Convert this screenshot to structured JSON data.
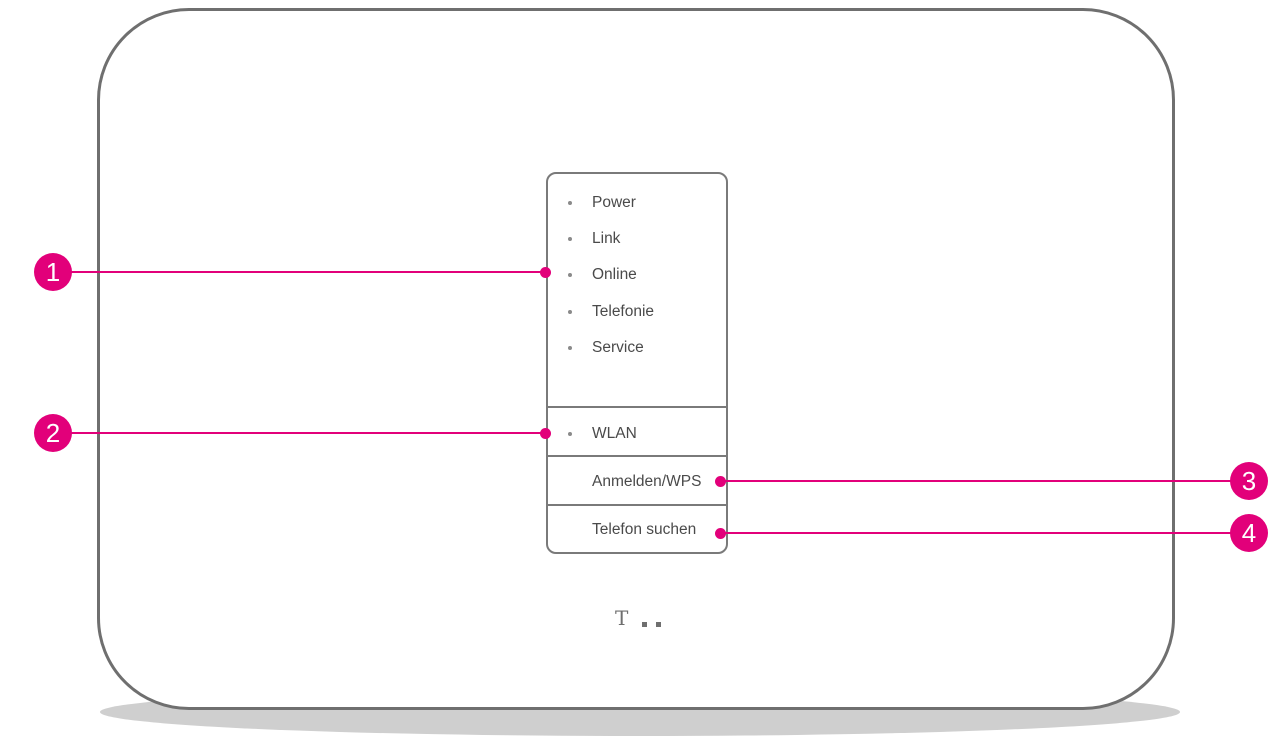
{
  "leds_top": [
    "Power",
    "Link",
    "Online",
    "Telefonie",
    "Service"
  ],
  "led_wlan": "WLAN",
  "buttons": {
    "wps": "Anmelden/WPS",
    "phone": "Telefon suchen"
  },
  "logo": "T",
  "callouts": [
    "1",
    "2",
    "3",
    "4"
  ],
  "colors": {
    "accent": "#e2007a",
    "outline": "#6f6f6f",
    "shadow": "#cfcfcf"
  }
}
